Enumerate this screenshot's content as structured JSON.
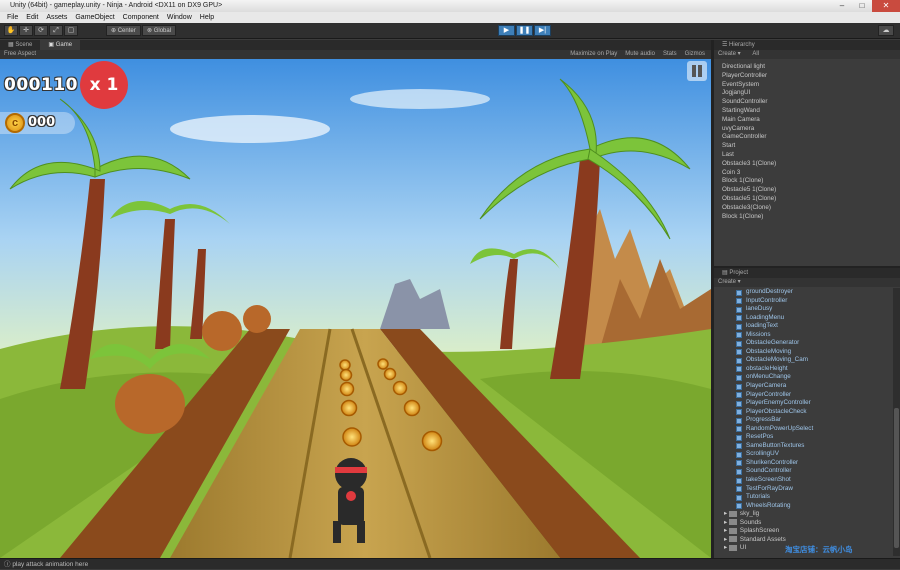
{
  "window": {
    "title": "Unity (64bit) - gameplay.unity - Ninja - Android <DX11 on DX9 GPU>"
  },
  "menu": [
    "File",
    "Edit",
    "Assets",
    "GameObject",
    "Component",
    "Window",
    "Help"
  ],
  "toolbar": {
    "tools": [
      "✋",
      "✛",
      "⟳",
      "⤢",
      "▢"
    ],
    "pivot_label": "Center",
    "space_label": "Global",
    "play_icon": "▶",
    "pause_icon": "❚❚",
    "step_icon": "▶|",
    "layers_icon": "☁"
  },
  "game_view": {
    "tabs": [
      "Scene",
      "Game"
    ],
    "aspect": "Free Aspect",
    "options": [
      "Maximize on Play",
      "Mute audio",
      "Stats",
      "Gizmos"
    ],
    "score": "000110",
    "multiplier": "x 1",
    "coins": "000",
    "coin_symbol": "c"
  },
  "hierarchy": {
    "title": "Hierarchy",
    "create_label": "Create ▾",
    "search_placeholder": "All",
    "items": [
      {
        "label": "Directional light",
        "child": false
      },
      {
        "label": "PlayerController",
        "child": false
      },
      {
        "label": "EventSystem",
        "child": false
      },
      {
        "label": "JogjangUI",
        "child": false
      },
      {
        "label": "SoundController",
        "child": false
      },
      {
        "label": "StartingWand",
        "child": false
      },
      {
        "label": "Main Camera",
        "child": false
      },
      {
        "label": "uvyCamera",
        "child": false
      },
      {
        "label": "GameController",
        "child": false
      },
      {
        "label": "Start",
        "child": false
      },
      {
        "label": "Last",
        "child": false
      },
      {
        "label": "Obstacle3 1(Clone)",
        "child": false
      },
      {
        "label": "Coin 3",
        "child": false
      },
      {
        "label": "Block 1(Clone)",
        "child": false
      },
      {
        "label": "Obstacle5 1(Clone)",
        "child": false
      },
      {
        "label": "Obstacle5 1(Clone)",
        "child": false
      },
      {
        "label": "Obstacle3(Clone)",
        "child": false
      },
      {
        "label": "Block 1(Clone)",
        "child": false
      }
    ]
  },
  "project": {
    "title": "Project",
    "create_label": "Create ▾",
    "scripts": [
      "groundDestroyer",
      "InputController",
      "laneDusy",
      "LoadingMenu",
      "loadingText",
      "Missions",
      "ObstacleGenerator",
      "ObstacleMoving",
      "ObstacleMoving_Cam",
      "obstacleHeight",
      "onMenuChange",
      "PlayerCamera",
      "PlayerController",
      "PlayerEnemyController",
      "PlayerObstacleCheck",
      "ProgressBar",
      "RandomPowerUpSelect",
      "ResetPos",
      "SameButtonTextures",
      "ScrollingUV",
      "ShurikenController",
      "SoundController",
      "takeScreenShot",
      "TestForRayDraw",
      "Tutorials",
      "WheelsRotating"
    ],
    "folders": [
      "sky_lig",
      "Sounds",
      "SplashScreen",
      "Standard Assets",
      "UI"
    ]
  },
  "watermark": "淘宝店铺：云帆小岛",
  "status": {
    "message": "play attack animation here"
  }
}
